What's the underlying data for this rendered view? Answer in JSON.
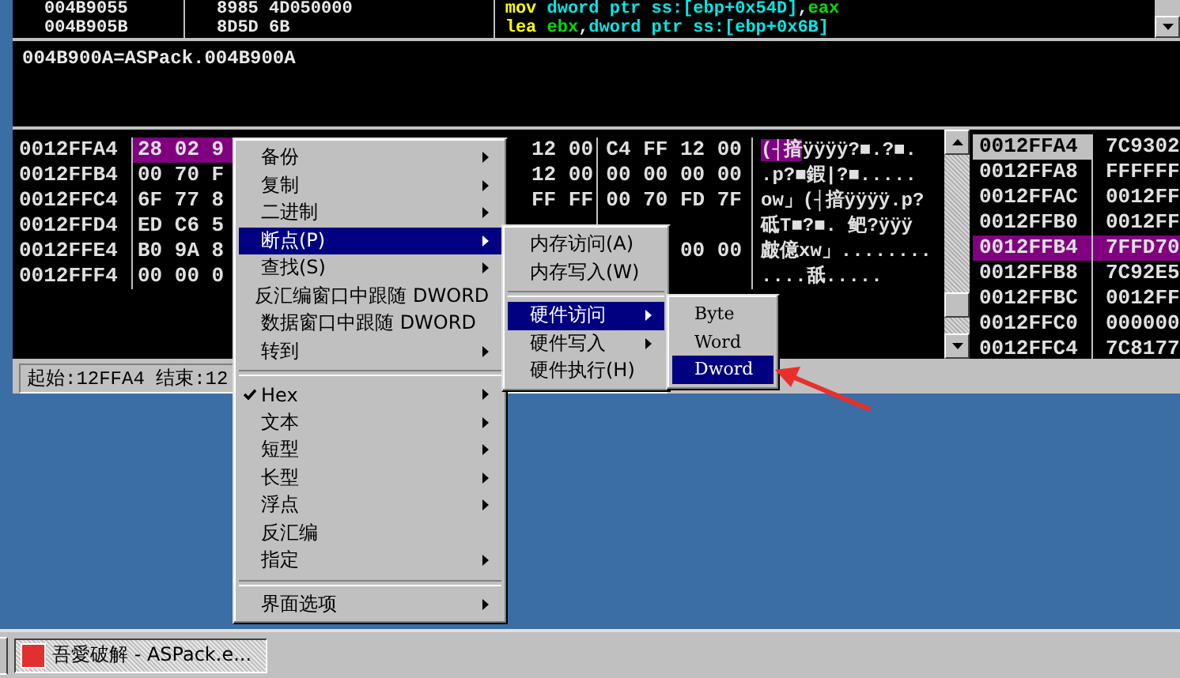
{
  "code_rows": [
    {
      "address": "004B9055",
      "bytes": "8985 4D050000",
      "tokens": [
        {
          "kind": "mnemonic",
          "text": "mov "
        },
        {
          "kind": "memory",
          "text": "dword ptr ss:[ebp+0x54D]"
        },
        {
          "kind": "plain",
          "text": ","
        },
        {
          "kind": "register",
          "text": "eax"
        }
      ]
    },
    {
      "address": "004B905B",
      "bytes": "8D5D 6B",
      "tokens": [
        {
          "kind": "mnemonic",
          "text": "lea "
        },
        {
          "kind": "register",
          "text": "ebx"
        },
        {
          "kind": "plain",
          "text": ","
        },
        {
          "kind": "memory",
          "text": "dword ptr ss:[ebp+0x6B]"
        }
      ]
    }
  ],
  "info": "004B900A=ASPack.004B900A",
  "dump_rows": [
    {
      "address": "0012FFA4",
      "hex_left": "28 02 9",
      "hex_mid": "12 00",
      "hex_right": "C4 FF 12 00",
      "ascii_marked": "(┤揞",
      "ascii": "ÿÿÿÿ?■.?■.",
      "selected": true
    },
    {
      "address": "0012FFB4",
      "hex_left": "00 70 F",
      "hex_mid": "12 00",
      "hex_right": "00 00 00 00",
      "ascii": ".p?■鍜|?■.....",
      "selected": false
    },
    {
      "address": "0012FFC4",
      "hex_left": "6F 77 8",
      "hex_mid": "FF FF",
      "hex_right": "00 70 FD 7F",
      "ascii": "ow」(┤揞ÿÿÿÿ.p?",
      "selected": false
    },
    {
      "address": "0012FFD4",
      "hex_left": "ED C6 5",
      "ascii": "砥T■?■. 鲃?ÿÿÿ",
      "selected": false
    },
    {
      "address": "0012FFE4",
      "hex_left": "B0 9A 8",
      "hex_right": "00 00",
      "ascii": "皻億xw」........",
      "selected": false
    },
    {
      "address": "0012FFF4",
      "hex_left": "00 00 0",
      "ascii": "....舐.....",
      "selected": false
    }
  ],
  "stack_rows": [
    {
      "address": "0012FFA4",
      "value": "7C9302",
      "selected": false,
      "current": true
    },
    {
      "address": "0012FFA8",
      "value": "FFFFFF",
      "selected": false,
      "current": false
    },
    {
      "address": "0012FFAC",
      "value": "0012FF",
      "selected": false,
      "current": false
    },
    {
      "address": "0012FFB0",
      "value": "0012FF",
      "selected": false,
      "current": false
    },
    {
      "address": "0012FFB4",
      "value": "7FFD70",
      "selected": true,
      "current": false
    },
    {
      "address": "0012FFB8",
      "value": "7C92E5",
      "selected": false,
      "current": false
    },
    {
      "address": "0012FFBC",
      "value": "0012FF",
      "selected": false,
      "current": false
    },
    {
      "address": "0012FFC0",
      "value": "000000",
      "selected": false,
      "current": false
    },
    {
      "address": "0012FFC4",
      "value": "7C8177",
      "selected": false,
      "current": false
    }
  ],
  "status_bar": "起始:12FFA4 结束:12",
  "context_menu": [
    {
      "kind": "item",
      "label": "备份",
      "submenu": true,
      "selected": false,
      "checked": false
    },
    {
      "kind": "item",
      "label": "复制",
      "submenu": true,
      "selected": false,
      "checked": false
    },
    {
      "kind": "item",
      "label": "二进制",
      "submenu": true,
      "selected": false,
      "checked": false
    },
    {
      "kind": "item",
      "label": "断点(P)",
      "submenu": true,
      "selected": true,
      "checked": false
    },
    {
      "kind": "item",
      "label": "查找(S)",
      "submenu": true,
      "selected": false,
      "checked": false
    },
    {
      "kind": "item",
      "label": "反汇编窗口中跟随 DWORD",
      "submenu": false,
      "selected": false,
      "checked": false
    },
    {
      "kind": "item",
      "label": "数据窗口中跟随 DWORD",
      "submenu": false,
      "selected": false,
      "checked": false
    },
    {
      "kind": "item",
      "label": "转到",
      "submenu": true,
      "selected": false,
      "checked": false
    },
    {
      "kind": "separator"
    },
    {
      "kind": "item",
      "label": "Hex",
      "submenu": true,
      "selected": false,
      "checked": true
    },
    {
      "kind": "item",
      "label": "文本",
      "submenu": true,
      "selected": false,
      "checked": false
    },
    {
      "kind": "item",
      "label": "短型",
      "submenu": true,
      "selected": false,
      "checked": false
    },
    {
      "kind": "item",
      "label": "长型",
      "submenu": true,
      "selected": false,
      "checked": false
    },
    {
      "kind": "item",
      "label": "浮点",
      "submenu": true,
      "selected": false,
      "checked": false
    },
    {
      "kind": "item",
      "label": "反汇编",
      "submenu": false,
      "selected": false,
      "checked": false
    },
    {
      "kind": "item",
      "label": "指定",
      "submenu": true,
      "selected": false,
      "checked": false
    },
    {
      "kind": "separator"
    },
    {
      "kind": "item",
      "label": "界面选项",
      "submenu": true,
      "selected": false,
      "checked": false
    }
  ],
  "breakpoint_menu": [
    {
      "kind": "item",
      "label": "内存访问(A)",
      "submenu": false,
      "selected": false
    },
    {
      "kind": "item",
      "label": "内存写入(W)",
      "submenu": false,
      "selected": false
    },
    {
      "kind": "separator"
    },
    {
      "kind": "item",
      "label": "硬件访问",
      "submenu": true,
      "selected": true
    },
    {
      "kind": "item",
      "label": "硬件写入",
      "submenu": true,
      "selected": false
    },
    {
      "kind": "item",
      "label": "硬件执行(H)",
      "submenu": false,
      "selected": false
    }
  ],
  "hardware_menu": [
    {
      "kind": "item",
      "label": "Byte",
      "selected": false
    },
    {
      "kind": "item",
      "label": "Word",
      "selected": false
    },
    {
      "kind": "item",
      "label": "Dword",
      "selected": true
    }
  ],
  "taskbar": {
    "label": "吾愛破解 - ASPack.e...",
    "pressed": true
  }
}
